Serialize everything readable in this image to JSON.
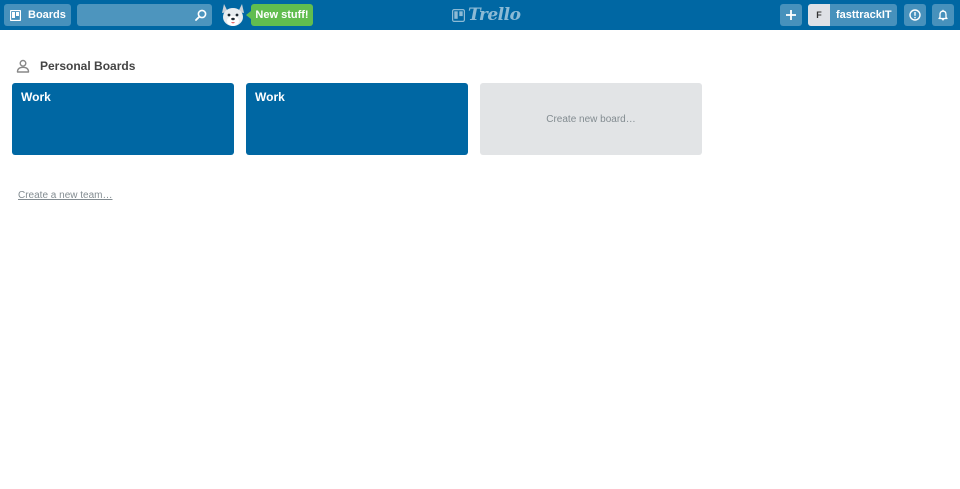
{
  "header": {
    "boards_label": "Boards",
    "search": {
      "value": "",
      "placeholder": ""
    },
    "new_stuff_label": "New stuff!",
    "logo_text": "Trello",
    "member": {
      "initial": "F",
      "name": "fasttrackIT"
    },
    "icons": {
      "boards": "boards-icon",
      "search": "search-icon",
      "add": "plus-icon",
      "info": "info-icon",
      "notifications": "bell-icon"
    },
    "colors": {
      "bar": "#0067a3",
      "new_stuff": "#61bd4f"
    }
  },
  "personal_boards": {
    "title": "Personal Boards",
    "icon": "person-icon",
    "boards": [
      {
        "title": "Work",
        "color": "#0067a3"
      },
      {
        "title": "Work",
        "color": "#0067a3"
      }
    ],
    "create_board_label": "Create new board…"
  },
  "create_team_label": "Create a new team…"
}
